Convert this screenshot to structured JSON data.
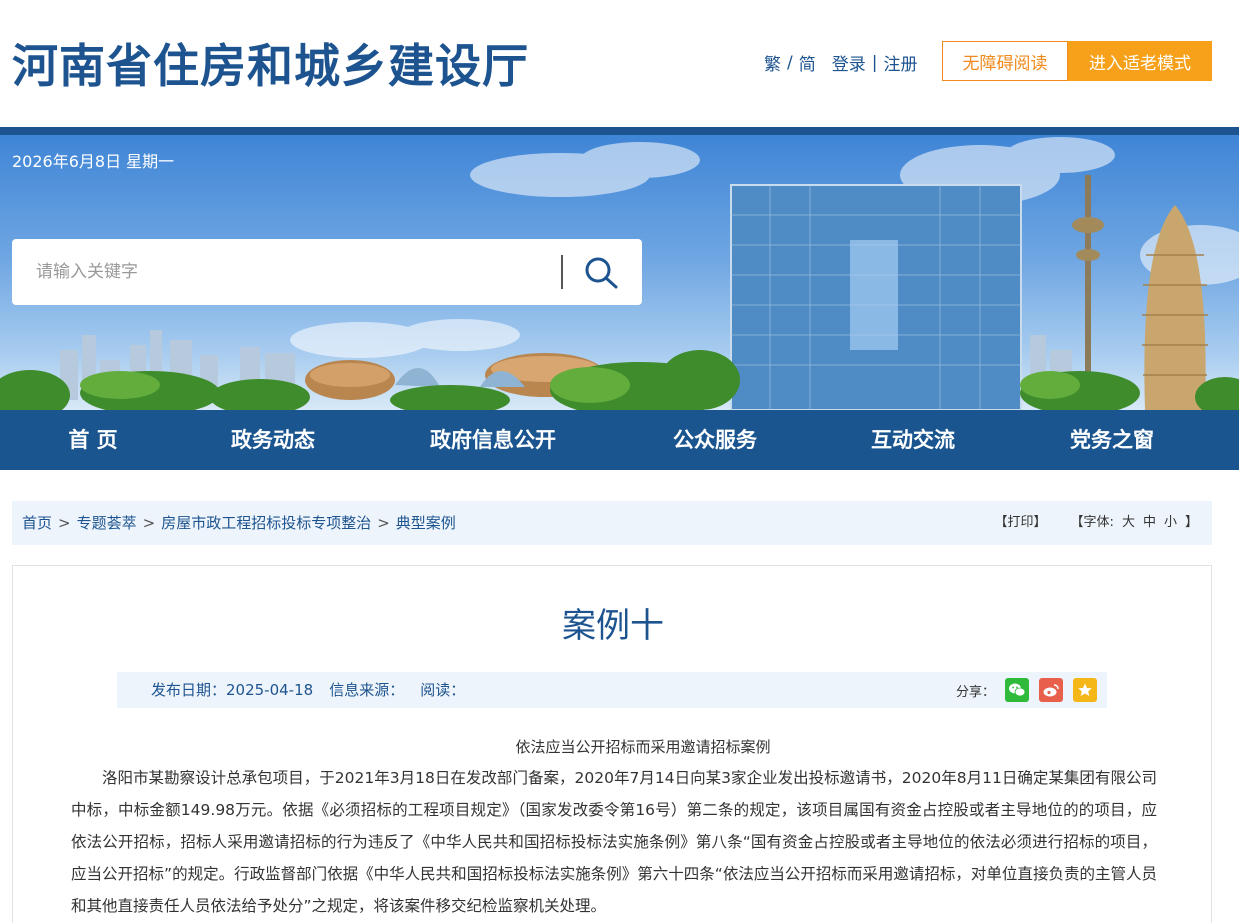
{
  "header": {
    "site_title": "河南省住房和城乡建设厅",
    "lang_trad": "繁",
    "lang_sep": "/",
    "lang_simp": "简",
    "login": "登录",
    "auth_sep": "|",
    "register": "注册",
    "accessible_button": "无障碍阅读",
    "elder_mode_button": "进入适老模式"
  },
  "banner": {
    "date": "2026年6月8日 星期一",
    "search_placeholder": "请输入关键字"
  },
  "nav": {
    "items": [
      "首 页",
      "政务动态",
      "政府信息公开",
      "公众服务",
      "互动交流",
      "党务之窗"
    ]
  },
  "breadcrumb": {
    "items": [
      "首页",
      "专题荟萃",
      "房屋市政工程招标投标专项整治",
      "典型案例"
    ],
    "separator": ">",
    "print": "【打印】",
    "font_label": "【字体:",
    "font_large": "大",
    "font_medium": "中",
    "font_small": "小",
    "font_close": "】"
  },
  "article": {
    "title": "案例十",
    "publish_date": "发布日期：2025-04-18",
    "source": "信息来源：",
    "views": "阅读：",
    "share_label": "分享：",
    "subheading": "依法应当公开招标而采用邀请招标案例",
    "paragraph": "洛阳市某勘察设计总承包项目，于2021年3月18日在发改部门备案，2020年7月14日向某3家企业发出投标邀请书，2020年8月11日确定某集团有限公司中标，中标金额149.98万元。依据《必须招标的工程项目规定》（国家发改委令第16号）第二条的规定，该项目属国有资金占控股或者主导地位的的项目，应依法公开招标，招标人采用邀请招标的行为违反了《中华人民共和国招标投标法实施条例》第八条“国有资金占控股或者主导地位的依法必须进行招标的项目，应当公开招标”的规定。行政监督部门依据《中华人民共和国招标投标法实施条例》第六十四条“依法应当公开招标而采用邀请招标，对单位直接负责的主管人员和其他直接责任人员依法给予处分”之规定，将该案件移交纪检监察机关处理。"
  },
  "colors": {
    "brand_blue": "#1d5490",
    "accent_orange": "#f7a11a",
    "wechat_green": "#2fba3c",
    "weibo_red": "#e8604c",
    "favorite_yellow": "#f5b617"
  }
}
